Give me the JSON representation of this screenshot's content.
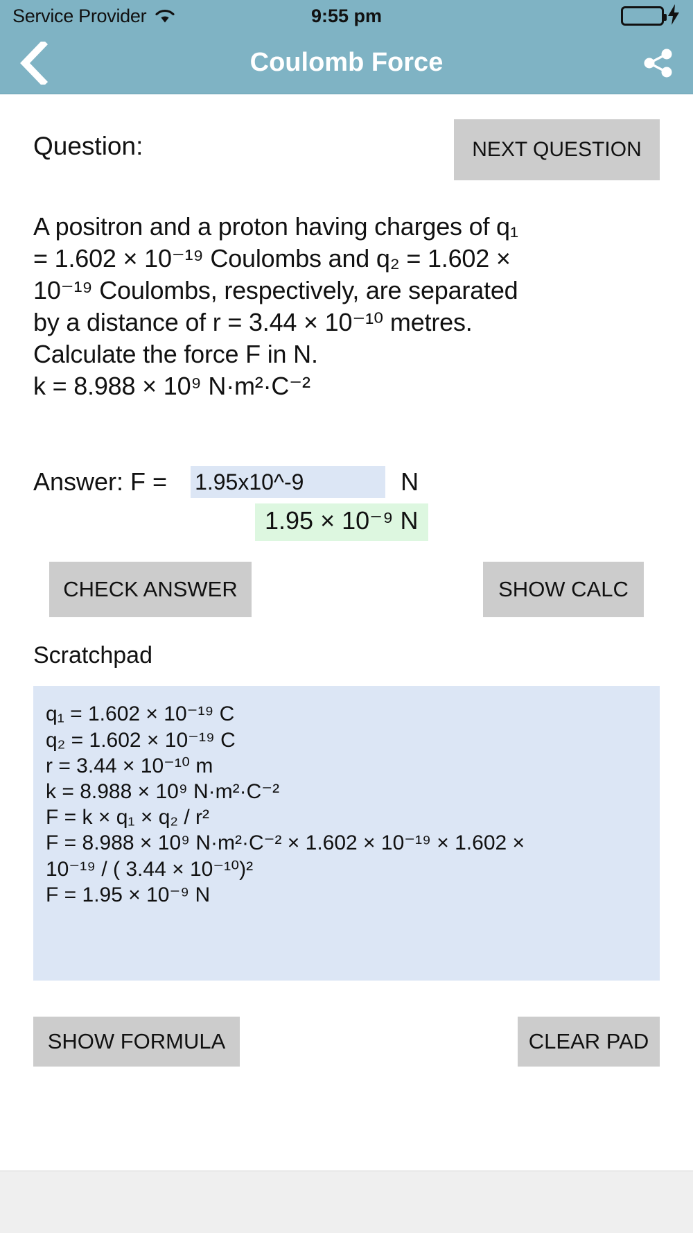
{
  "status_bar": {
    "carrier": "Service Provider",
    "wifi_icon": "wifi-icon",
    "time": "9:55 pm",
    "battery_icon": "battery-icon",
    "charging_icon": "lightning-bolt-icon"
  },
  "nav_bar": {
    "back_icon": "chevron-left-icon",
    "title": "Coulomb Force",
    "share_icon": "share-icon",
    "background_color": "#7fb3c4"
  },
  "question_section": {
    "label": "Question:",
    "next_button": "NEXT QUESTION",
    "lines": [
      "A positron  and  a proton having charges of q₁",
      "= 1.602 × 10⁻¹⁹ Coulombs  and  q₂ = 1.602 ×",
      "10⁻¹⁹ Coulombs, respectively, are separated",
      "by a distance of r = 3.44 × 10⁻¹⁰ metres.",
      "Calculate the  force F in N.",
      "k = 8.988 × 10⁹ N·m²·C⁻²"
    ]
  },
  "answer_section": {
    "label": "Answer:  F =",
    "input_value": "1.95x10^-9",
    "input_placeholder": "",
    "unit": "N",
    "result": "1.95 × 10⁻⁹ N",
    "result_background": "#ddf7e0",
    "input_background": "#dce6f5",
    "check_button": "CHECK ANSWER",
    "show_calc_button": "SHOW CALC"
  },
  "scratchpad": {
    "title": "Scratchpad",
    "background": "#dce6f5",
    "lines": [
      "q₁ = 1.602 × 10⁻¹⁹ C",
      "q₂ = 1.602 × 10⁻¹⁹ C",
      "r =  3.44 × 10⁻¹⁰ m",
      "k = 8.988 × 10⁹ N·m²·C⁻²",
      "F = k × q₁ × q₂ / r²",
      "F = 8.988 × 10⁹ N·m²·C⁻² ×  1.602 × 10⁻¹⁹  ×  1.602 ×",
      "10⁻¹⁹  / ( 3.44 × 10⁻¹⁰)²",
      "F = 1.95 × 10⁻⁹ N"
    ]
  },
  "bottom_actions": {
    "show_formula_button": "SHOW FORMULA",
    "clear_pad_button": "CLEAR PAD"
  }
}
